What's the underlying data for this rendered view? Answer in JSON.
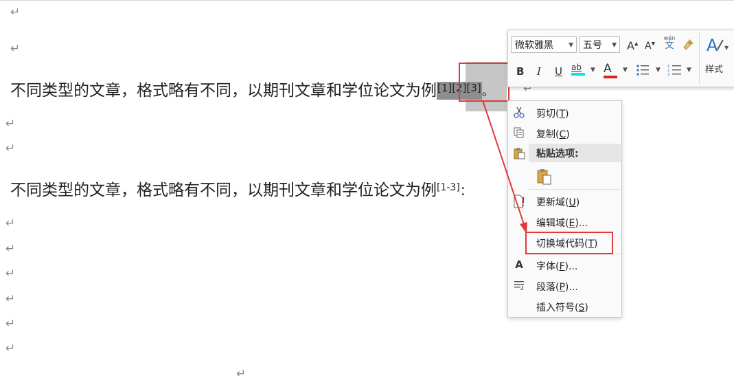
{
  "document": {
    "para_mark": "↵",
    "paragraph1": {
      "text": "不同类型的文章，格式略有不同，以期刊文章和学位论文为例",
      "citation": "[1][2][3]",
      "tail": "。"
    },
    "paragraph2": {
      "text": "不同类型的文章，格式略有不同，以期刊文章和学位论文为例",
      "citation": "[1-3]",
      "tail": "："
    }
  },
  "mini_toolbar": {
    "font_name": "微软雅黑",
    "font_size": "五号",
    "grow_font": "A",
    "shrink_font": "A",
    "phonetic_top": "wén",
    "phonetic_bottom": "文",
    "bold": "B",
    "italic": "I",
    "underline": "U",
    "highlight": "ab",
    "font_color": "A",
    "styles_label": "样式",
    "highlight_color": "#00e5e5",
    "font_color_bar": "#e02020"
  },
  "context_menu": {
    "cut": {
      "label": "剪切(",
      "key": "T",
      "end": ")"
    },
    "copy": {
      "label": "复制(",
      "key": "C",
      "end": ")"
    },
    "paste_options": "粘贴选项:",
    "update_field": {
      "label": "更新域(",
      "key": "U",
      "end": ")"
    },
    "edit_field": {
      "label": "编辑域(",
      "key": "E",
      "end": ")..."
    },
    "toggle_field_codes": {
      "label": "切换域代码(",
      "key": "T",
      "end": ")"
    },
    "font": {
      "label": "字体(",
      "key": "F",
      "end": ")..."
    },
    "paragraph": {
      "label": "段落(",
      "key": "P",
      "end": ")..."
    },
    "insert_symbol": {
      "label": "插入符号(",
      "key": "S",
      "end": ")"
    }
  },
  "colors": {
    "annotation_red": "#e0393a",
    "field_shading": "#c6c6c6",
    "field_highlight": "#8e8e8e"
  }
}
